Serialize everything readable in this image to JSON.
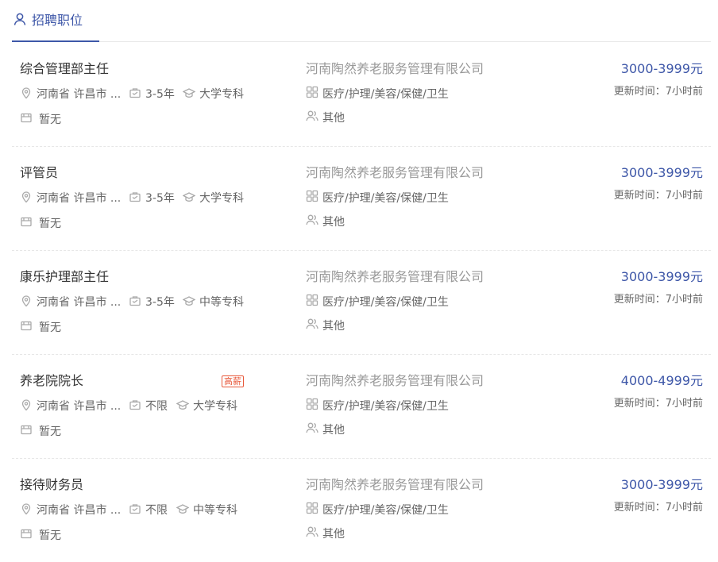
{
  "colors": {
    "accent": "#3e57a8",
    "tag": "#e85a3c",
    "muted": "#999999"
  },
  "tab": {
    "label": "招聘职位",
    "icon": "user-icon"
  },
  "jobs": [
    {
      "title": "综合管理部主任",
      "tag": "",
      "location": "河南省 许昌市 ...",
      "experience": "3-5年",
      "education": "大学专科",
      "welfare": "暂无",
      "company": "河南陶然养老服务管理有限公司",
      "industry": "医疗/护理/美容/保健/卫生",
      "company_size": "其他",
      "salary": "3000-3999元",
      "updated": "更新时间：7小时前"
    },
    {
      "title": "评管员",
      "tag": "",
      "location": "河南省 许昌市 ...",
      "experience": "3-5年",
      "education": "大学专科",
      "welfare": "暂无",
      "company": "河南陶然养老服务管理有限公司",
      "industry": "医疗/护理/美容/保健/卫生",
      "company_size": "其他",
      "salary": "3000-3999元",
      "updated": "更新时间：7小时前"
    },
    {
      "title": "康乐护理部主任",
      "tag": "",
      "location": "河南省 许昌市 ...",
      "experience": "3-5年",
      "education": "中等专科",
      "welfare": "暂无",
      "company": "河南陶然养老服务管理有限公司",
      "industry": "医疗/护理/美容/保健/卫生",
      "company_size": "其他",
      "salary": "3000-3999元",
      "updated": "更新时间：7小时前"
    },
    {
      "title": "养老院院长",
      "tag": "高薪",
      "location": "河南省 许昌市 ...",
      "experience": "不限",
      "education": "大学专科",
      "welfare": "暂无",
      "company": "河南陶然养老服务管理有限公司",
      "industry": "医疗/护理/美容/保健/卫生",
      "company_size": "其他",
      "salary": "4000-4999元",
      "updated": "更新时间：7小时前"
    },
    {
      "title": "接待财务员",
      "tag": "",
      "location": "河南省 许昌市 ...",
      "experience": "不限",
      "education": "中等专科",
      "welfare": "暂无",
      "company": "河南陶然养老服务管理有限公司",
      "industry": "医疗/护理/美容/保健/卫生",
      "company_size": "其他",
      "salary": "3000-3999元",
      "updated": "更新时间：7小时前"
    }
  ]
}
